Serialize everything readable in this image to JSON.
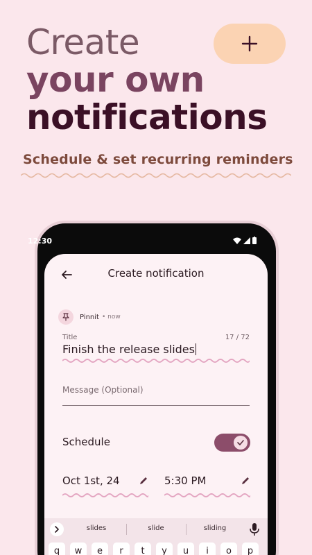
{
  "hero": {
    "line1": "Create",
    "line2": "your own",
    "line3": "notifications",
    "subtitle": "Schedule & set recurring reminders"
  },
  "hero_button": {
    "icon": "plus-icon"
  },
  "status_bar": {
    "time": "12:30",
    "icons": [
      "wifi-icon",
      "signal-icon",
      "battery-icon"
    ]
  },
  "screen": {
    "title": "Create notification",
    "back_icon": "arrow-back-icon",
    "app": {
      "name": "Pinnit",
      "time": "• now",
      "icon": "pin-icon"
    },
    "title_field": {
      "label": "Title",
      "value": "Finish the release slides",
      "count": "17 / 72"
    },
    "message_field": {
      "placeholder": "Message (Optional)"
    },
    "schedule": {
      "label": "Schedule",
      "enabled": true
    },
    "date": {
      "value": "Oct 1st, 24",
      "icon": "pencil-icon"
    },
    "time": {
      "value": "5:30 PM",
      "icon": "pencil-icon"
    }
  },
  "keyboard": {
    "suggestions": [
      "slides",
      "slide",
      "sliding"
    ],
    "keys": [
      "q",
      "w",
      "e",
      "r",
      "t",
      "y",
      "u",
      "i",
      "o",
      "p"
    ]
  },
  "colors": {
    "background": "#fbe7ec",
    "accent": "#8c4d6a",
    "hero_button": "#fbd3b3",
    "subtitle": "#7d4a3c",
    "wave": "#e3a4c0"
  }
}
